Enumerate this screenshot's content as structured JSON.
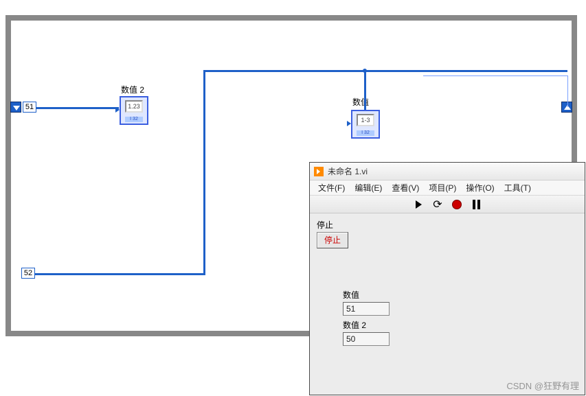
{
  "diagram": {
    "node2_label": "数值 2",
    "node1_label": "数值",
    "tunnel_top": "51",
    "tunnel_bottom": "52",
    "ind1_inner": "1-3",
    "ind2_inner": "1.23",
    "i32_label": "I 32"
  },
  "fp": {
    "title": "未命名 1.vi",
    "menu": {
      "file": "文件(F)",
      "edit": "编辑(E)",
      "view": "查看(V)",
      "project": "项目(P)",
      "operate": "操作(O)",
      "tools": "工具(T)"
    },
    "stop_label": "停止",
    "stop_button": "停止",
    "num1_label": "数值",
    "num1_value": "51",
    "num2_label": "数值 2",
    "num2_value": "50"
  },
  "watermark": "CSDN @狂野有理"
}
